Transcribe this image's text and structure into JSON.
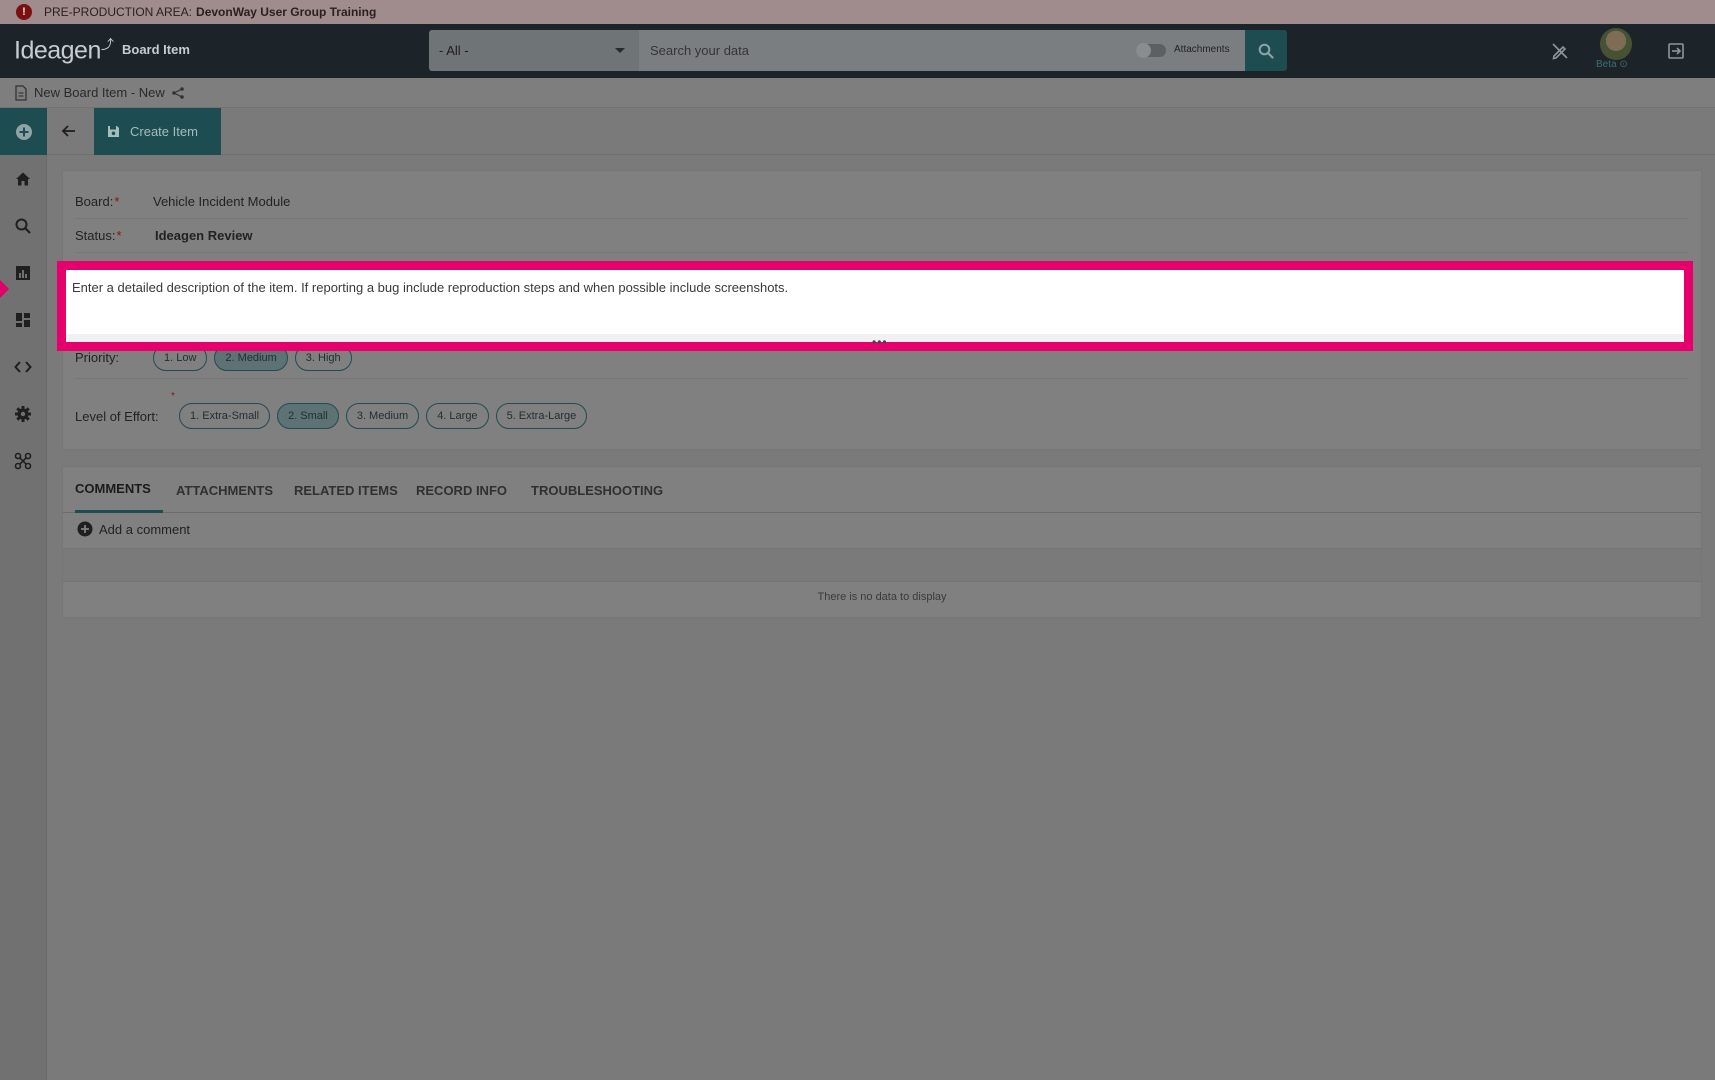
{
  "banner": {
    "prefix": "PRE-PRODUCTION AREA:",
    "environment": "DevonWay User Group Training",
    "alert_glyph": "!"
  },
  "header": {
    "logo_text": "Ideagen",
    "module_title": "Board Item",
    "scope_value": "- All -",
    "search_placeholder": "Search your data",
    "attachments_toggle_label": "Attachments",
    "beta_label": "Beta"
  },
  "breadcrumb": {
    "title": "New Board Item - New"
  },
  "toolbar": {
    "create_label": "Create Item"
  },
  "form": {
    "board_label": "Board:",
    "board_value": "Vehicle Incident Module",
    "status_label": "Status:",
    "status_value": "Ideagen Review",
    "description_value": "Enter a detailed description of the item. If reporting a bug include reproduction steps and when possible include screenshots.",
    "priority_label": "Priority:",
    "priority_options": [
      "1. Low",
      "2. Medium",
      "3. High"
    ],
    "priority_selected": "2. Medium",
    "effort_label": "Level of Effort:",
    "effort_options": [
      "1. Extra-Small",
      "2. Small",
      "3. Medium",
      "4. Large",
      "5. Extra-Large"
    ],
    "effort_selected": "2. Small",
    "required_mark": "*"
  },
  "tabs": [
    {
      "label": "COMMENTS",
      "active": true
    },
    {
      "label": "ATTACHMENTS",
      "active": false
    },
    {
      "label": "RELATED ITEMS",
      "active": false
    },
    {
      "label": "RECORD INFO",
      "active": false
    },
    {
      "label": "TROUBLESHOOTING",
      "active": false
    }
  ],
  "comments": {
    "add_label": "Add a comment",
    "empty_message": "There is no data to display"
  },
  "colors": {
    "brand_teal": "#1d4d51",
    "highlight": "#e6006e",
    "banner": "#a08c8c",
    "topbar": "#1d2429"
  },
  "icons": {
    "sidebar": [
      "home-icon",
      "search-icon",
      "chart-icon",
      "dashboard-icon",
      "code-icon",
      "gear-icon",
      "network-icon"
    ],
    "header_right": [
      "edit-off-icon",
      "avatar",
      "logout-icon"
    ]
  }
}
